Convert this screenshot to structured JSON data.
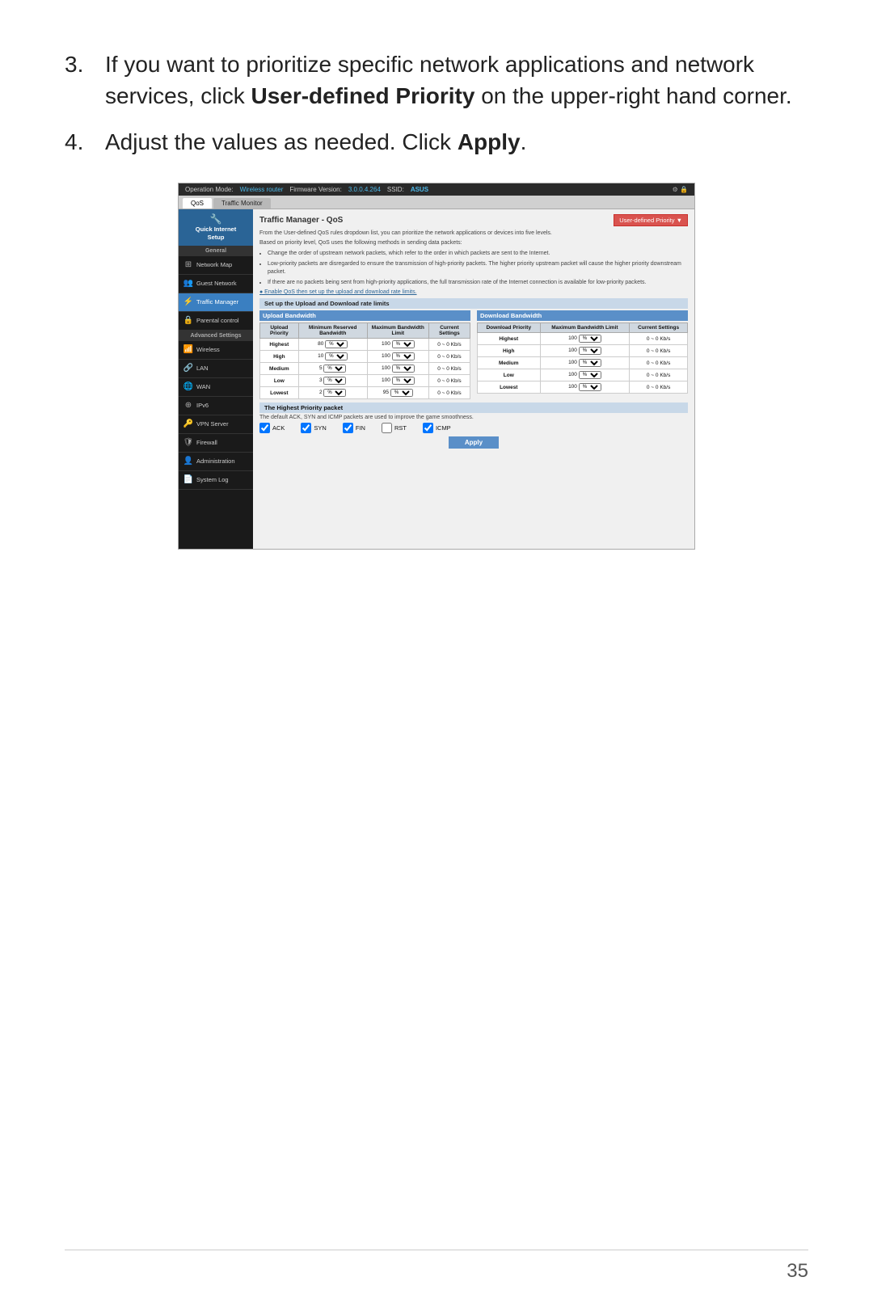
{
  "page": {
    "number": "35"
  },
  "instructions": [
    {
      "number": "3.",
      "text": "If you want to prioritize specific network applications and network services, click ",
      "bold": "User-defined Priority",
      "text2": " on the upper-right hand corner."
    },
    {
      "number": "4.",
      "text": "Adjust the values as needed. Click ",
      "bold": "Apply",
      "text2": "."
    }
  ],
  "router": {
    "topbar": {
      "mode_label": "Operation Mode:",
      "mode_value": "Wireless router",
      "fw_label": "Firmware Version:",
      "fw_value": "3.0.0.4.264",
      "ssid_label": "SSID:",
      "ssid_value": "ASUS"
    },
    "tabs": [
      {
        "label": "QoS",
        "active": true
      },
      {
        "label": "Traffic Monitor",
        "active": false
      }
    ],
    "sidebar": {
      "quick_setup": "Quick Internet Setup",
      "items": [
        {
          "label": "General",
          "icon": "",
          "divider": true
        },
        {
          "label": "Network Map",
          "icon": "⊞"
        },
        {
          "label": "Guest Network",
          "icon": "👥"
        },
        {
          "label": "Traffic Manager",
          "icon": "⚡",
          "active": true
        },
        {
          "label": "Parental control",
          "icon": "🔒"
        },
        {
          "label": "Advanced Settings",
          "icon": "",
          "divider": true
        },
        {
          "label": "Wireless",
          "icon": "📶"
        },
        {
          "label": "LAN",
          "icon": "🔗"
        },
        {
          "label": "WAN",
          "icon": "🌐"
        },
        {
          "label": "IPv6",
          "icon": "⊕"
        },
        {
          "label": "VPN Server",
          "icon": "🔑"
        },
        {
          "label": "Firewall",
          "icon": "🛡"
        },
        {
          "label": "Administration",
          "icon": "👤"
        },
        {
          "label": "System Log",
          "icon": "📄"
        }
      ]
    },
    "content": {
      "title": "Traffic Manager - QoS",
      "user_defined_btn": "User-defined Priority",
      "desc1": "From the User-defined QoS rules dropdown list, you can prioritize the network applications or devices into five levels.",
      "desc2": "Based on priority level, QoS uses the following methods in sending data packets:",
      "bullets": [
        "Change the order of upstream network packets, which refer to the order in which packets are sent to the Internet.",
        "Low-priority packets are disregarded to ensure the transmission of high-priority packets. The higher priority upstream packet will cause the higher priority downstream packet.",
        "If there are no packets being sent from high-priority applications, the full transmission rate of the Internet connection is available for low-priority packets."
      ],
      "enable_link": "Enable QoS then set up the upload and download rate limits.",
      "section1": "Set up the Upload and Download rate limits",
      "upload_header": "Upload Bandwidth",
      "download_header": "Download Bandwidth",
      "upload_table": {
        "headers": [
          "Upload Priority",
          "Minimum Reserved Bandwidth",
          "Maximum Bandwidth Limit",
          "Current Settings"
        ],
        "rows": [
          {
            "priority": "Highest",
            "min": "80",
            "max": "100",
            "current": "0 ~ 0 Kb/s"
          },
          {
            "priority": "High",
            "min": "10",
            "max": "100",
            "current": "0 ~ 0 Kb/s"
          },
          {
            "priority": "Medium",
            "min": "5",
            "max": "100",
            "current": "0 ~ 0 Kb/s"
          },
          {
            "priority": "Low",
            "min": "3",
            "max": "100",
            "current": "0 ~ 0 Kb/s"
          },
          {
            "priority": "Lowest",
            "min": "2",
            "max": "95",
            "current": "0 ~ 0 Kb/s"
          }
        ]
      },
      "download_table": {
        "headers": [
          "Download Priority",
          "Maximum Bandwidth Limit",
          "Current Settings"
        ],
        "rows": [
          {
            "priority": "Highest",
            "max": "100",
            "current": "0 ~ 0 Kb/s"
          },
          {
            "priority": "High",
            "max": "100",
            "current": "0 ~ 0 Kb/s"
          },
          {
            "priority": "Medium",
            "max": "100",
            "current": "0 ~ 0 Kb/s"
          },
          {
            "priority": "Low",
            "max": "100",
            "current": "0 ~ 0 Kb/s"
          },
          {
            "priority": "Lowest",
            "max": "100",
            "current": "0 ~ 0 Kb/s"
          }
        ]
      },
      "highest_section": "The Highest Priority packet",
      "highest_desc": "The default ACK, SYN and ICMP packets are used to improve the game smoothness.",
      "checkboxes": [
        {
          "label": "ACK",
          "checked": true
        },
        {
          "label": "SYN",
          "checked": true
        },
        {
          "label": "FIN",
          "checked": true
        },
        {
          "label": "RST",
          "checked": false
        },
        {
          "label": "ICMP",
          "checked": true
        }
      ],
      "apply_btn": "Apply"
    }
  }
}
